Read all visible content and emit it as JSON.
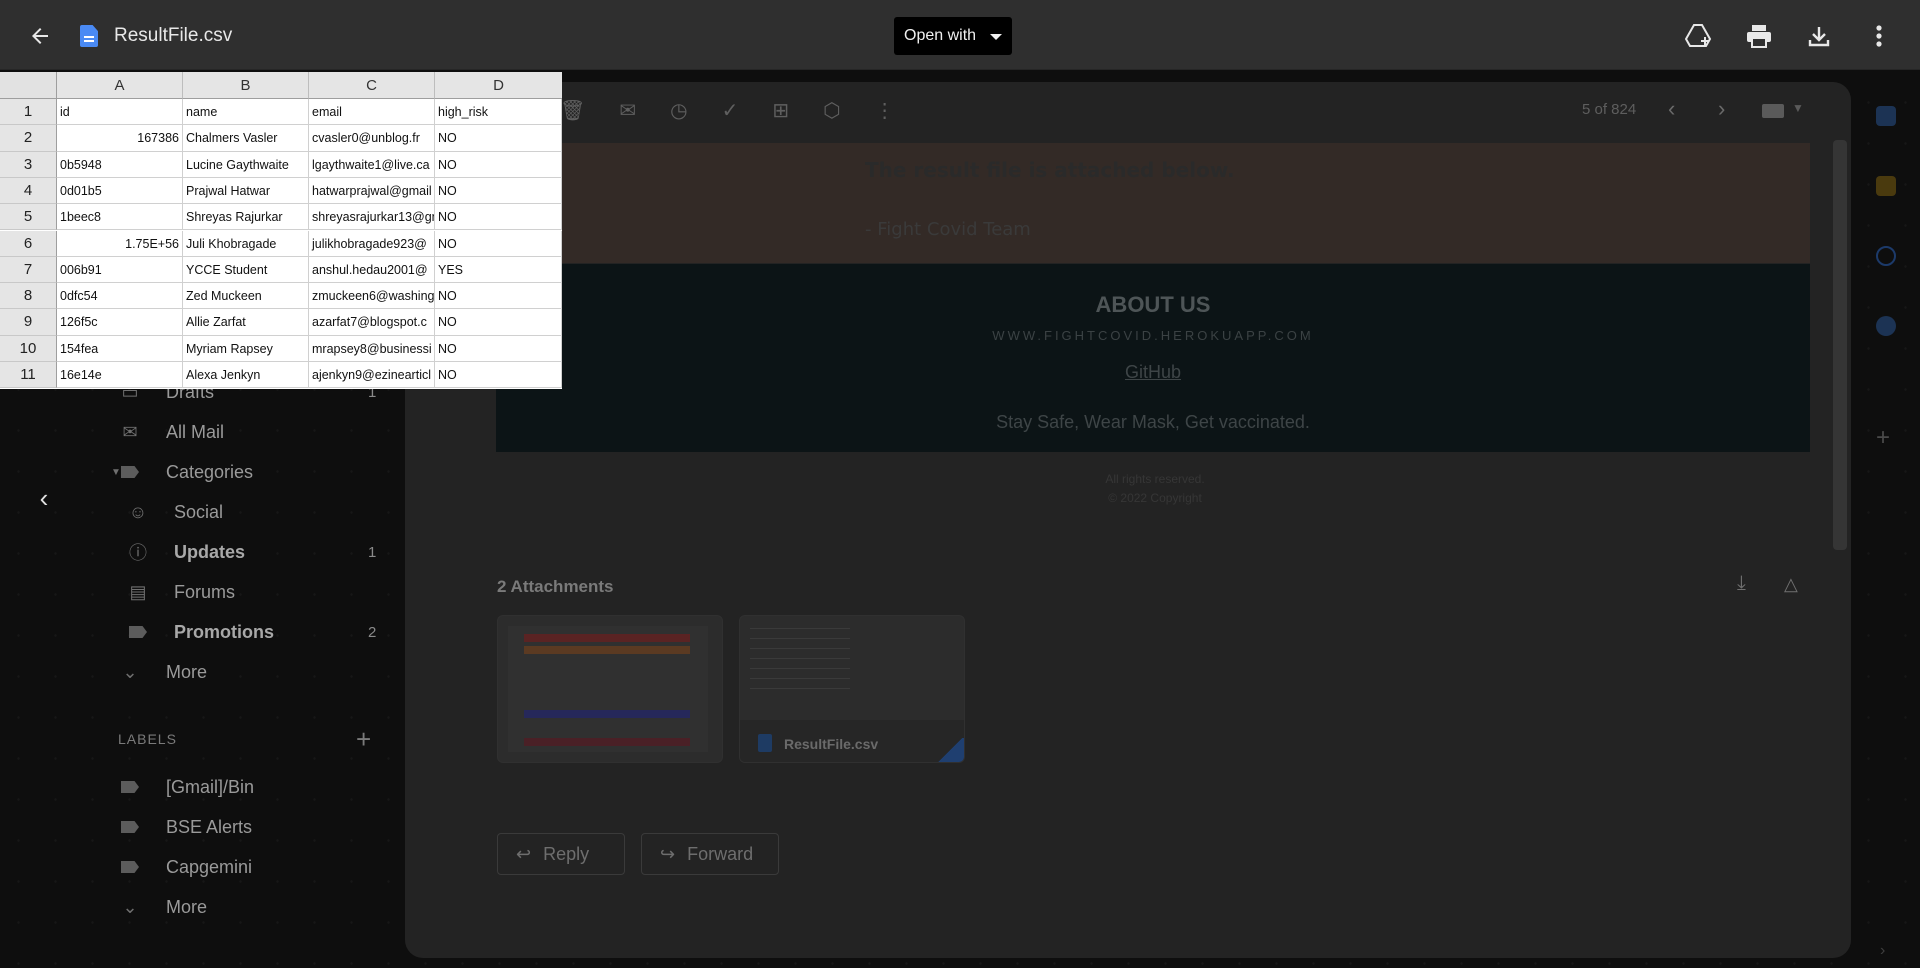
{
  "viewer": {
    "file_name": "ResultFile.csv",
    "open_with": "Open with"
  },
  "sheet": {
    "columns": [
      "A",
      "B",
      "C",
      "D"
    ],
    "rows": [
      {
        "n": "1",
        "cells": [
          "id",
          "name",
          "email",
          "high_risk"
        ],
        "num": false
      },
      {
        "n": "2",
        "cells": [
          "167386",
          "Chalmers Vasler",
          "cvasler0@unblog.fr",
          "NO"
        ],
        "num": true
      },
      {
        "n": "3",
        "cells": [
          "0b5948",
          "Lucine Gaythwaite",
          "lgaythwaite1@live.ca",
          "NO"
        ],
        "num": false
      },
      {
        "n": "4",
        "cells": [
          "0d01b5",
          "Prajwal Hatwar",
          "hatwarprajwal@gmail",
          "NO"
        ],
        "num": false
      },
      {
        "n": "5",
        "cells": [
          "1beec8",
          "Shreyas Rajurkar",
          "shreyasrajurkar13@gm",
          "NO"
        ],
        "num": false
      },
      {
        "n": "6",
        "cells": [
          "1.75E+56",
          "Juli Khobragade",
          "julikhobragade923@",
          "NO"
        ],
        "num": true
      },
      {
        "n": "7",
        "cells": [
          "006b91",
          "YCCE Student",
          "anshul.hedau2001@",
          "YES"
        ],
        "num": false
      },
      {
        "n": "8",
        "cells": [
          "0dfc54",
          "Zed Muckeen",
          "zmuckeen6@washing",
          "NO"
        ],
        "num": false
      },
      {
        "n": "9",
        "cells": [
          "126f5c",
          "Allie Zarfat",
          "azarfat7@blogspot.c",
          "NO"
        ],
        "num": false
      },
      {
        "n": "10",
        "cells": [
          "154fea",
          "Myriam Rapsey",
          "mrapsey8@businessi",
          "NO"
        ],
        "num": false
      },
      {
        "n": "11",
        "cells": [
          "16e14e",
          "Alexa Jenkyn",
          "ajenkyn9@ezinearticl",
          "NO"
        ],
        "num": false
      }
    ]
  },
  "gmail": {
    "nav": [
      {
        "label": "Drafts",
        "count": "1",
        "top": "partial"
      },
      {
        "label": "All Mail",
        "count": ""
      },
      {
        "label": "Categories",
        "count": ""
      },
      {
        "label": "Social",
        "count": ""
      },
      {
        "label": "Updates",
        "count": "1"
      },
      {
        "label": "Forums",
        "count": ""
      },
      {
        "label": "Promotions",
        "count": "2"
      },
      {
        "label": "More",
        "count": ""
      }
    ],
    "labels_heading": "LABELS",
    "labels": [
      "[Gmail]/Bin",
      "BSE Alerts",
      "Capgemini",
      "More"
    ],
    "pager": "5 of 824",
    "message": {
      "result_line": "The result file is attached below.",
      "team_line": "- Fight Covid Team",
      "about_title": "ABOUT US",
      "about_url": "WWW.FIGHTCOVID.HEROKUAPP.COM",
      "github": "GitHub",
      "stay_safe": "Stay Safe, Wear Mask, Get vaccinated.",
      "rights_1": "All rights reserved.",
      "rights_2": "© 2022 Copyright"
    },
    "attachments_title": "2 Attachments",
    "attachment_csv_name": "ResultFile.csv",
    "reply_label": "Reply",
    "forward_label": "Forward"
  },
  "colors": {
    "topbar": "#2f2f2f",
    "docs_blue": "#4a8af4",
    "sheet_header": "#e5e5e5"
  }
}
